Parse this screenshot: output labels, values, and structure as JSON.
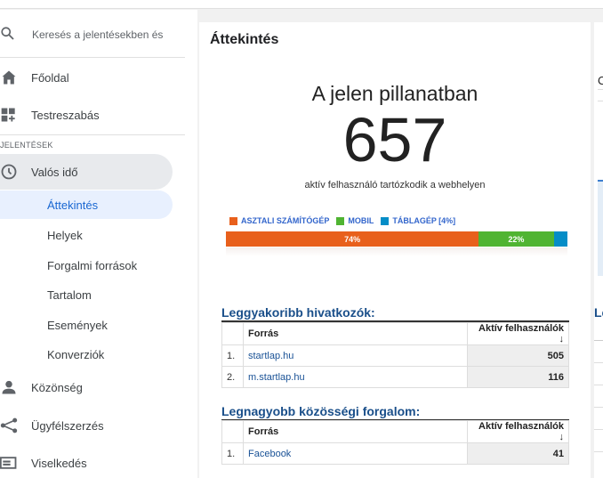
{
  "sidebar": {
    "search_placeholder": "Keresés a jelentésekben és",
    "home": "Főoldal",
    "customize": "Testreszabás",
    "reports_section": "JELENTÉSEK",
    "realtime": "Valós idő",
    "realtime_children": [
      "Áttekintés",
      "Helyek",
      "Forgalmi források",
      "Tartalom",
      "Események",
      "Konverziók"
    ],
    "audience": "Közönség",
    "acquisition": "Ügyfélszerzés",
    "behavior": "Viselkedés"
  },
  "main": {
    "page_title": "Áttekintés",
    "now_title": "A jelen pillanatban",
    "active_users": "657",
    "subtitle": "aktív felhasználó tartózkodik a webhelyen",
    "device_legend": [
      {
        "label": "ASZTALI SZÁMÍTÓGÉP",
        "color": "#e8601c"
      },
      {
        "label": "MOBIL",
        "color": "#50b432"
      },
      {
        "label": "TÁBLAGÉP [4%]",
        "color": "#058dc7"
      }
    ],
    "device_bar": [
      {
        "percent": 74,
        "label": "74%",
        "color": "#e8601c"
      },
      {
        "percent": 22,
        "label": "22%",
        "color": "#50b432"
      },
      {
        "percent": 4,
        "label": "",
        "color": "#058dc7"
      }
    ],
    "referrers": {
      "title": "Leggyakoribb hivatkozók:",
      "col_source": "Forrás",
      "col_active": "Aktív felhasználók",
      "rows": [
        {
          "idx": "1.",
          "source": "startlap.hu",
          "value": "505"
        },
        {
          "idx": "2.",
          "source": "m.startlap.hu",
          "value": "116"
        }
      ]
    },
    "social": {
      "title": "Legnagyobb közösségi forgalom:",
      "col_source": "Forrás",
      "col_active": "Aktív felhasználók",
      "rows": [
        {
          "idx": "1.",
          "source": "Facebook",
          "value": "41"
        }
      ]
    }
  },
  "right_panel": {
    "partial_heading": "C",
    "partial_section": "Le"
  }
}
